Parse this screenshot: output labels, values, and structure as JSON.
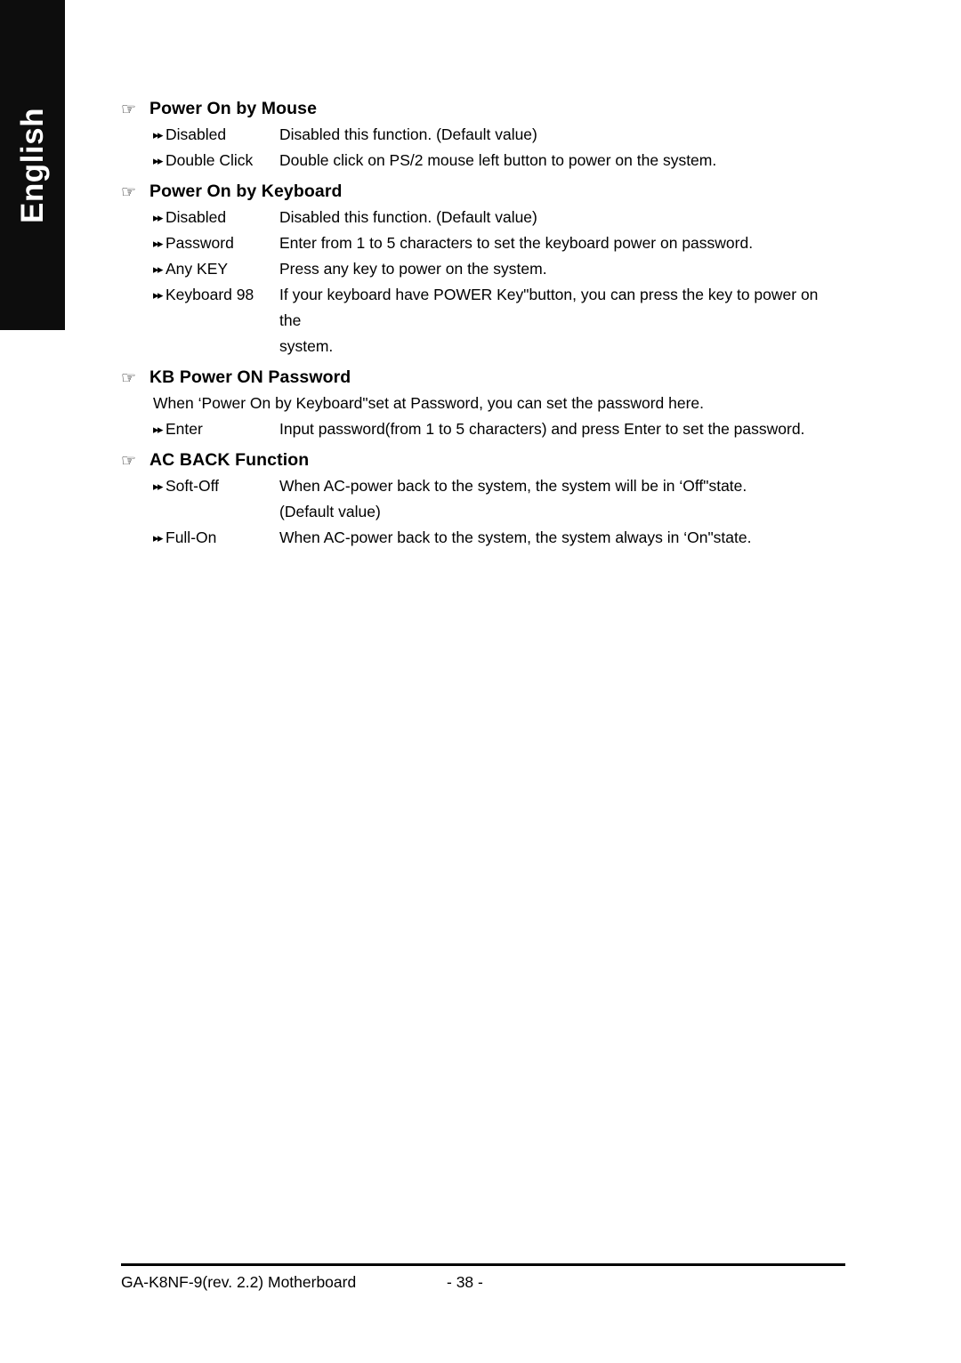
{
  "sidebar": {
    "language_label": "English"
  },
  "icons": {
    "hand": "☞",
    "double_arrow": "▸▸"
  },
  "sections": [
    {
      "title": "Power On by Mouse",
      "options": [
        {
          "term": "Disabled",
          "desc": "Disabled this function. (Default value)"
        },
        {
          "term": "Double Click",
          "desc": "Double click on PS/2 mouse left button to power on the system."
        }
      ]
    },
    {
      "title": "Power On by Keyboard",
      "options": [
        {
          "term": "Disabled",
          "desc": "Disabled this function. (Default value)"
        },
        {
          "term": "Password",
          "desc": "Enter from 1 to 5 characters to set the keyboard power on password."
        },
        {
          "term": "Any KEY",
          "desc": "Press any key to power on the system."
        },
        {
          "term": "Keyboard 98",
          "desc": "If your keyboard have POWER Key\"button, you can press the key to power on the",
          "desc_cont": "system."
        }
      ]
    },
    {
      "title": "KB Power ON Password",
      "intro": "When ‘Power On by Keyboard\"set at Password, you can set the password here.",
      "options": [
        {
          "term": "Enter",
          "desc": "Input password(from 1 to 5 characters) and press Enter to set the password."
        }
      ]
    },
    {
      "title": "AC BACK Function",
      "options": [
        {
          "term": "Soft-Off",
          "desc": "When AC-power back to the system, the system will be in ‘Off\"state.",
          "desc_cont": "(Default value)"
        },
        {
          "term": "Full-On",
          "desc": "When AC-power back to the system, the system always in ‘On\"state."
        }
      ]
    }
  ],
  "footer": {
    "left": "GA-K8NF-9(rev. 2.2) Motherboard",
    "page": "- 38 -"
  }
}
